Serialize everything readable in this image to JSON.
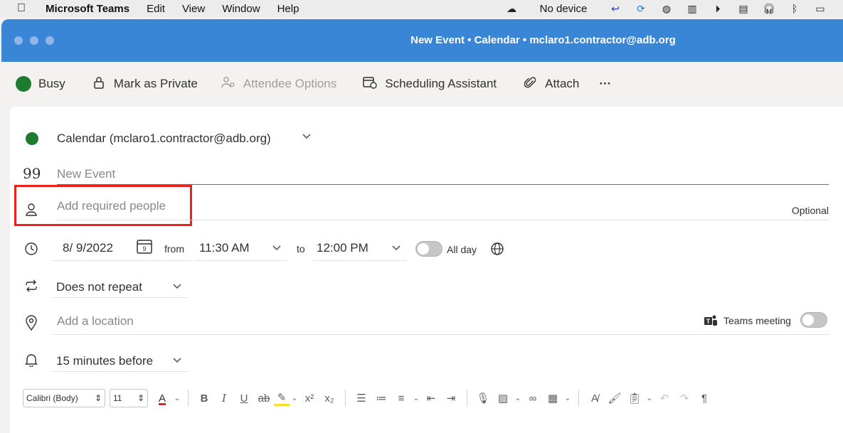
{
  "menubar": {
    "apple": "",
    "app_name": "Microsoft Teams",
    "items": [
      "Edit",
      "View",
      "Window",
      "Help"
    ],
    "no_device": "No device"
  },
  "window": {
    "title": "New Event • Calendar • mclaro1.contractor@adb.org"
  },
  "toolbar": {
    "busy": "Busy",
    "mark_private": "Mark as Private",
    "attendee_options": "Attendee Options",
    "scheduling_assistant": "Scheduling Assistant",
    "attach": "Attach",
    "more": "···"
  },
  "form": {
    "calendar": "Calendar (mclaro1.contractor@adb.org)",
    "title_placeholder": "New Event",
    "required_placeholder": "Add required people",
    "optional": "Optional",
    "date": "8/ 9/2022",
    "date_icon_day": "9",
    "from_label": "from",
    "start_time": "11:30 AM",
    "to_label": "to",
    "end_time": "12:00 PM",
    "all_day": "All day",
    "repeat": "Does not repeat",
    "location_placeholder": "Add a location",
    "teams_meeting": "Teams meeting",
    "reminder": "15 minutes before"
  },
  "format_bar": {
    "font": "Calibri (Body)",
    "size": "11"
  },
  "colors": {
    "titlebar": "#3a86d6",
    "busy": "#1e7a2e",
    "highlight_box": "#e8231b"
  }
}
